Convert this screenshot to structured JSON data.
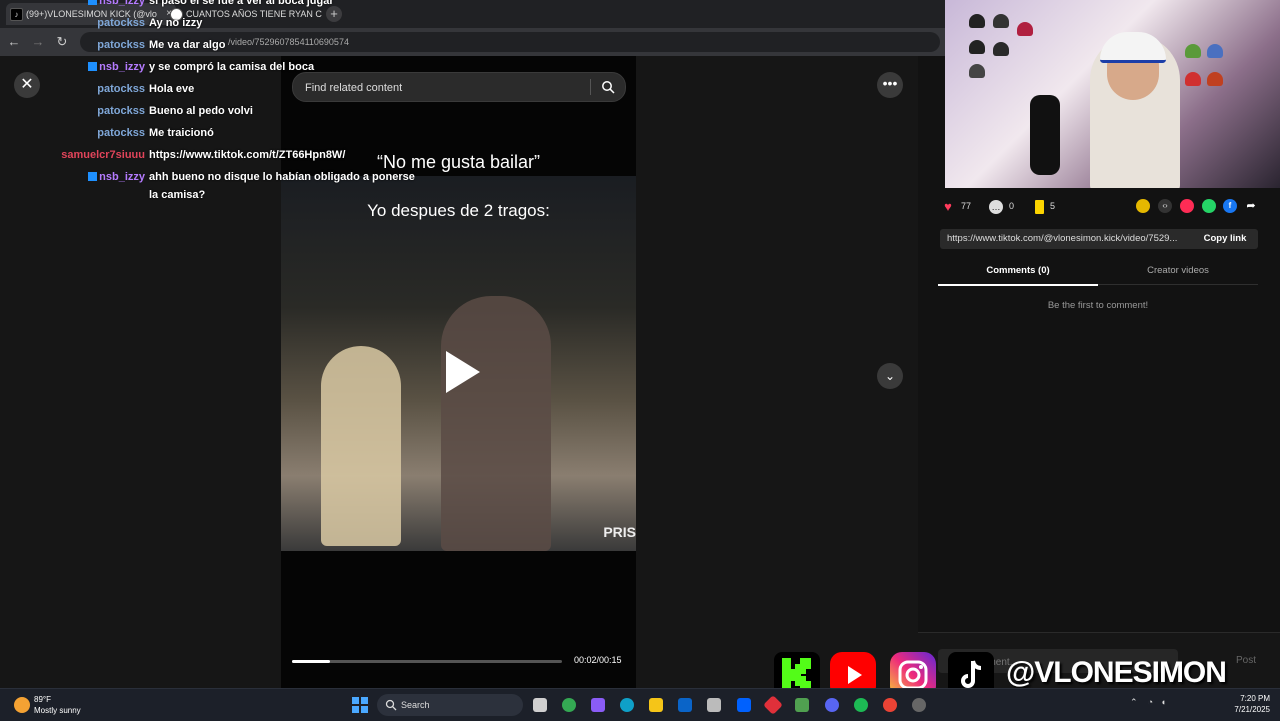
{
  "browser": {
    "tabs": [
      {
        "label": "(99+)VLONESIMON KICK (@vlo"
      },
      {
        "label": "CUANTOS AÑOS TIENE RYAN C"
      }
    ],
    "url_partial": "/video/7529607854110690574"
  },
  "chat": {
    "messages": [
      {
        "user": "nsb_izzy",
        "text": "si paso el se fue a ver al boca jugar",
        "color": "#b57bff",
        "badge": true
      },
      {
        "user": "patockss",
        "text": "Ay no izzy",
        "color": "#7fa7d8",
        "badge": false
      },
      {
        "user": "patockss",
        "text": "Me va dar algo",
        "color": "#7fa7d8",
        "badge": false
      },
      {
        "user": "nsb_izzy",
        "text": "y se compró la camisa del boca",
        "color": "#b57bff",
        "badge": true
      },
      {
        "user": "patockss",
        "text": "Hola eve",
        "color": "#7fa7d8",
        "badge": false
      },
      {
        "user": "patockss",
        "text": "Bueno al pedo volvi",
        "color": "#7fa7d8",
        "badge": false
      },
      {
        "user": "patockss",
        "text": "Me traicionó",
        "color": "#7fa7d8",
        "badge": false
      },
      {
        "user": "samuelcr7siuuu",
        "text": "https://www.tiktok.com/t/ZT66Hpn8W/",
        "color": "#e0445a",
        "badge": false
      },
      {
        "user": "nsb_izzy",
        "text": "ahh bueno no disque lo habían obligado a ponerse",
        "color": "#b57bff",
        "badge": true
      },
      {
        "user": "",
        "text": "la camisa?",
        "color": "#b57bff",
        "badge": false
      }
    ]
  },
  "search": {
    "placeholder": "Find related content"
  },
  "video": {
    "overlay_text_1": "“No me gusta bailar”",
    "overlay_text_2": "Yo despues de 2 tragos:",
    "watermark": "PRIS",
    "time": "00:02/00:15",
    "progress": 0.14
  },
  "stats": {
    "likes": "77",
    "comments": "0",
    "saves": "5"
  },
  "link": {
    "url": "https://www.tiktok.com/@vlonesimon.kick/video/7529...",
    "copy_label": "Copy link"
  },
  "panel_tabs": [
    {
      "label": "Comments (0)",
      "active": true
    },
    {
      "label": "Creator videos",
      "active": false
    }
  ],
  "empty_comments": "Be the first to comment!",
  "comment_input": {
    "placeholder": "Add comment...",
    "post_label": "Post"
  },
  "overlay": {
    "handle": "@VLONESIMON"
  },
  "taskbar": {
    "temperature": "89°F",
    "weather": "Mostly sunny",
    "search_label": "Search",
    "time": "7:20 PM",
    "date": "7/21/2025"
  },
  "colors": {
    "like": "#ff3b5c",
    "save": "#fcd400",
    "kick_green": "#53fc18",
    "youtube_red": "#ff0000"
  }
}
